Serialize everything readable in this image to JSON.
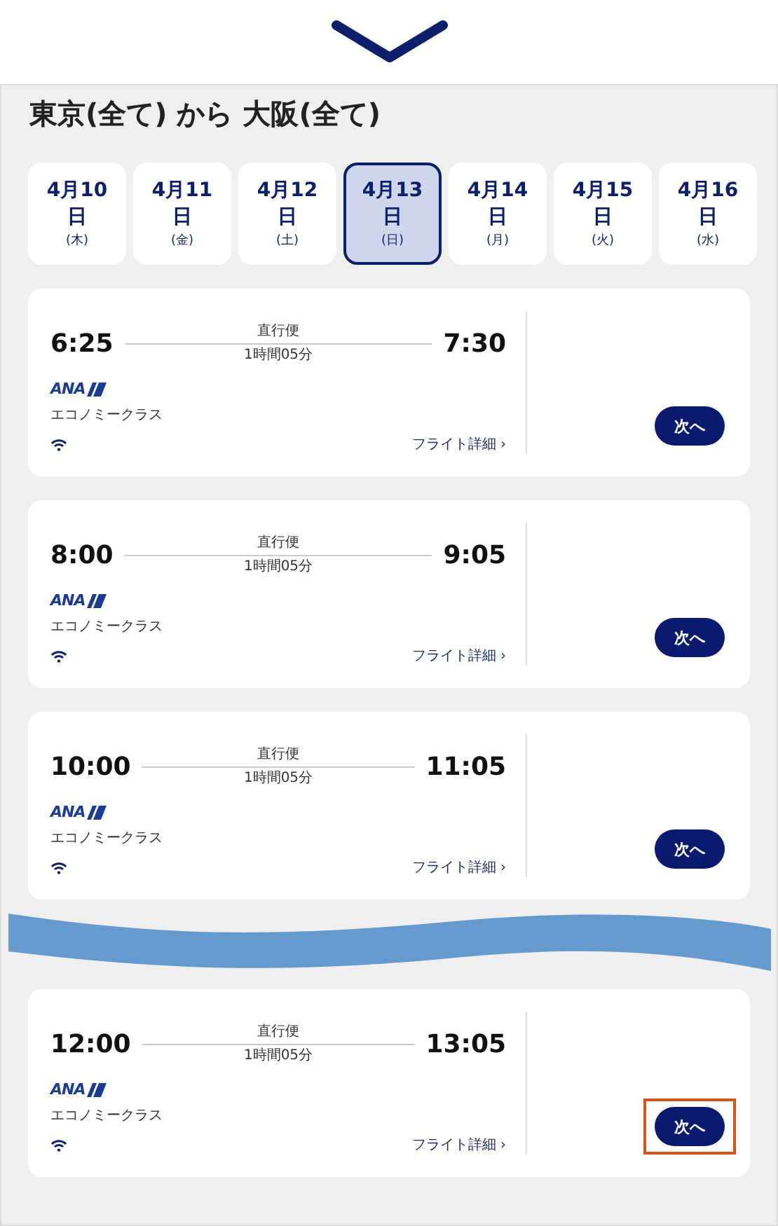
{
  "route_title": "東京(全て) から 大阪(全て)",
  "dates": [
    {
      "date": "4月10",
      "unit": "日",
      "weekday": "(木)",
      "selected": false
    },
    {
      "date": "4月11",
      "unit": "日",
      "weekday": "(金)",
      "selected": false
    },
    {
      "date": "4月12",
      "unit": "日",
      "weekday": "(土)",
      "selected": false
    },
    {
      "date": "4月13",
      "unit": "日",
      "weekday": "(日)",
      "selected": true
    },
    {
      "date": "4月14",
      "unit": "日",
      "weekday": "(月)",
      "selected": false
    },
    {
      "date": "4月15",
      "unit": "日",
      "weekday": "(火)",
      "selected": false
    },
    {
      "date": "4月16",
      "unit": "日",
      "weekday": "(水)",
      "selected": false
    }
  ],
  "flights": [
    {
      "depart": "6:25",
      "arrive": "7:30",
      "type": "直行便",
      "duration": "1時間05分",
      "airline": "ANA",
      "cabin": "エコノミークラス",
      "details_link": "フライト詳細 ›",
      "next_button": "次へ",
      "highlighted": false,
      "gap_before": false
    },
    {
      "depart": "8:00",
      "arrive": "9:05",
      "type": "直行便",
      "duration": "1時間05分",
      "airline": "ANA",
      "cabin": "エコノミークラス",
      "details_link": "フライト詳細 ›",
      "next_button": "次へ",
      "highlighted": false,
      "gap_before": false
    },
    {
      "depart": "10:00",
      "arrive": "11:05",
      "type": "直行便",
      "duration": "1時間05分",
      "airline": "ANA",
      "cabin": "エコノミークラス",
      "details_link": "フライト詳細 ›",
      "next_button": "次へ",
      "highlighted": false,
      "gap_before": false
    },
    {
      "depart": "12:00",
      "arrive": "13:05",
      "type": "直行便",
      "duration": "1時間05分",
      "airline": "ANA",
      "cabin": "エコノミークラス",
      "details_link": "フライト詳細 ›",
      "next_button": "次へ",
      "highlighted": true,
      "gap_before": true
    }
  ]
}
